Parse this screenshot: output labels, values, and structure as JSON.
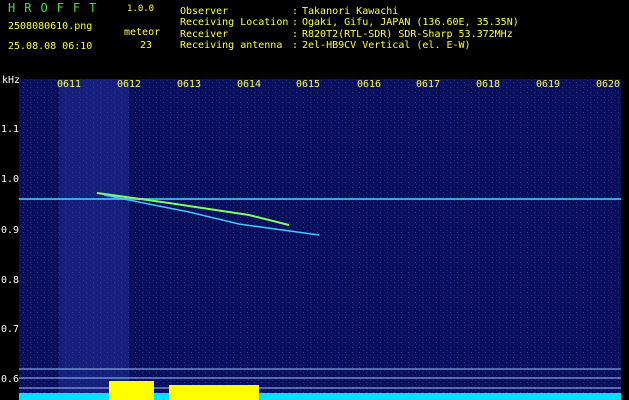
{
  "header": {
    "app_title": "HROFFT",
    "version": "1.0.0",
    "file_name": "2508080610.png",
    "meteor_label": "meteor",
    "meteor_count": "23",
    "datetime": "25.08.08 06:10"
  },
  "info": [
    {
      "label": "Observer",
      "value": "Takanori Kawachi"
    },
    {
      "label": "Receiving Location",
      "value": "Ogaki, Gifu, JAPAN (136.60E, 35.35N)"
    },
    {
      "label": "Receiver",
      "value": "R820T2(RTL-SDR) SDR-Sharp 53.372MHz"
    },
    {
      "label": "Receiving antenna",
      "value": "2el-HB9CV Vertical (el. E-W)"
    }
  ],
  "axis": {
    "unit": "kHz",
    "x_ticks": [
      "0611",
      "0612",
      "0613",
      "0614",
      "0615",
      "0616",
      "0617",
      "0618",
      "0619",
      "0620"
    ],
    "y_ticks": [
      "1.1",
      "1.0",
      "0.9",
      "0.8",
      "0.7",
      "0.6"
    ]
  },
  "colors": {
    "background": "#0a0f5c",
    "signal": "#40e0ff",
    "level": "#ffff00",
    "text_green": "#40e040",
    "text_yellow": "#ffff40"
  }
}
